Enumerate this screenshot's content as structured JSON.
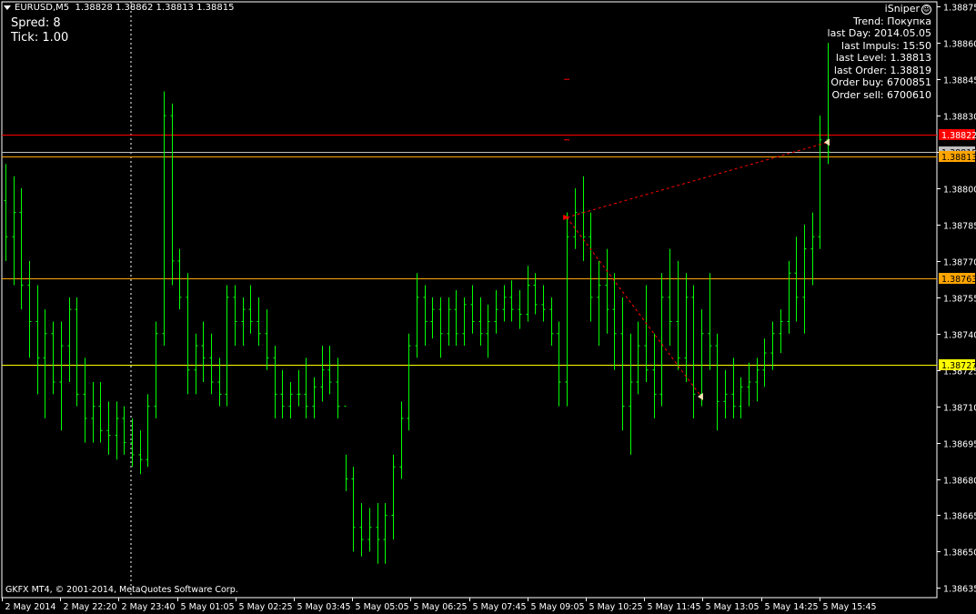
{
  "header": {
    "symbol": "EURUSD,M5",
    "ohlc": "1.38828 1.38862 1.38813 1.38815"
  },
  "info_left": {
    "spread": "Spred: 8",
    "tick": "Tick: 1.00"
  },
  "panel": {
    "title": "iSniper",
    "icon": "smiley-icon",
    "lines": [
      "Trend: Покупка",
      "last Day: 2014.05.05",
      "last Impuls: 15:50",
      "last Level: 1.38813",
      "last Order: 1.38819",
      "Order buy: 6700851",
      "Order sell: 6700610"
    ]
  },
  "copyright": "GKFX MT4, © 2001-2014, MetaQuotes Software Corp.",
  "colors": {
    "background": "#000000",
    "bars": "#00ff00",
    "axis": "#ffffff",
    "level_red": "#ff0000",
    "level_orange": "#ffa500",
    "level_yellow": "#ffff00",
    "level_grey": "#c0c0c0",
    "trade_line": "#ff0000"
  },
  "chart_data": {
    "type": "ohlc",
    "x_tick_labels": [
      "2 May 2014",
      "2 May 22:20",
      "2 May 23:40",
      "5 May 01:05",
      "5 May 02:25",
      "5 May 03:45",
      "5 May 05:05",
      "5 May 06:25",
      "5 May 07:45",
      "5 May 09:05",
      "5 May 10:25",
      "5 May 11:45",
      "5 May 13:05",
      "5 May 14:25",
      "5 May 15:45"
    ],
    "y_ticks": [
      1.38875,
      1.3886,
      1.38845,
      1.3883,
      1.38815,
      1.388,
      1.38785,
      1.3877,
      1.38755,
      1.3874,
      1.38725,
      1.3871,
      1.38695,
      1.3868,
      1.38665,
      1.3865,
      1.38635
    ],
    "y_tick_labels": [
      "1.38875",
      "1.38860",
      "1.38845",
      "1.38830",
      "1.38815",
      "1.38800",
      "1.38785",
      "1.38770",
      "1.38755",
      "1.38740",
      "1.38725",
      "1.38710",
      "1.38695",
      "1.38680",
      "1.38665",
      "1.38650",
      "1.38635"
    ],
    "ylim": [
      1.38631,
      1.38877
    ],
    "levels": [
      {
        "price": 1.38822,
        "label": "1.38822",
        "color": "#ff0000"
      },
      {
        "price": 1.38815,
        "label": "1.38815",
        "color": "#c0c0c0"
      },
      {
        "price": 1.38813,
        "label": "1.38813",
        "color": "#ffa500"
      },
      {
        "price": 1.38763,
        "label": "1.38763",
        "color": "#ffa500"
      },
      {
        "price": 1.38727,
        "label": "1.38727",
        "color": "#ffff00"
      }
    ],
    "bars": [
      [
        1.38795,
        1.3881,
        1.3877,
        1.3878
      ],
      [
        1.3878,
        1.38805,
        1.3876,
        1.3879
      ],
      [
        1.3879,
        1.388,
        1.3875,
        1.3876
      ],
      [
        1.3876,
        1.3877,
        1.3873,
        1.38745
      ],
      [
        1.38745,
        1.3876,
        1.38715,
        1.3873
      ],
      [
        1.3873,
        1.3875,
        1.38705,
        1.3874
      ],
      [
        1.3874,
        1.38745,
        1.38715,
        1.3872
      ],
      [
        1.3872,
        1.38745,
        1.387,
        1.38735
      ],
      [
        1.38735,
        1.38755,
        1.3872,
        1.3875
      ],
      [
        1.3875,
        1.38755,
        1.3871,
        1.38715
      ],
      [
        1.38715,
        1.3873,
        1.38695,
        1.38705
      ],
      [
        1.38705,
        1.3872,
        1.38695,
        1.3871
      ],
      [
        1.3871,
        1.3872,
        1.38695,
        1.387
      ],
      [
        1.387,
        1.38712,
        1.3869,
        1.38698
      ],
      [
        1.38698,
        1.38712,
        1.38688,
        1.38705
      ],
      [
        1.38705,
        1.3871,
        1.3869,
        1.38695
      ],
      [
        1.38695,
        1.38705,
        1.38685,
        1.3869
      ],
      [
        1.3869,
        1.387,
        1.38682,
        1.38688
      ],
      [
        1.38688,
        1.38715,
        1.38685,
        1.3871
      ],
      [
        1.3871,
        1.38745,
        1.38705,
        1.3874
      ],
      [
        1.3874,
        1.3884,
        1.38735,
        1.3883
      ],
      [
        1.3883,
        1.38835,
        1.3876,
        1.3877
      ],
      [
        1.3877,
        1.38775,
        1.3875,
        1.38755
      ],
      [
        1.38755,
        1.38765,
        1.38715,
        1.38725
      ],
      [
        1.38725,
        1.3874,
        1.38715,
        1.38735
      ],
      [
        1.38735,
        1.38745,
        1.3872,
        1.3873
      ],
      [
        1.3873,
        1.3874,
        1.38715,
        1.3872
      ],
      [
        1.3872,
        1.3873,
        1.3871,
        1.38715
      ],
      [
        1.38715,
        1.3876,
        1.3871,
        1.38755
      ],
      [
        1.38755,
        1.3876,
        1.38735,
        1.38745
      ],
      [
        1.38745,
        1.38755,
        1.38735,
        1.3875
      ],
      [
        1.3875,
        1.3876,
        1.3874,
        1.38745
      ],
      [
        1.38745,
        1.38755,
        1.38735,
        1.3874
      ],
      [
        1.3874,
        1.3875,
        1.38725,
        1.3873
      ],
      [
        1.3873,
        1.38735,
        1.38705,
        1.38715
      ],
      [
        1.38715,
        1.38725,
        1.38705,
        1.3871
      ],
      [
        1.3871,
        1.3872,
        1.38705,
        1.38715
      ],
      [
        1.38715,
        1.38725,
        1.3871,
        1.38715
      ],
      [
        1.38715,
        1.3873,
        1.38705,
        1.3871
      ],
      [
        1.3871,
        1.38722,
        1.38705,
        1.38718
      ],
      [
        1.38718,
        1.38735,
        1.38712,
        1.38725
      ],
      [
        1.38725,
        1.38735,
        1.38715,
        1.3872
      ],
      [
        1.3872,
        1.3873,
        1.38705,
        1.3871
      ],
      [
        1.3871,
        1.3869,
        1.38675,
        1.3868
      ],
      [
        1.3868,
        1.38685,
        1.3865,
        1.3866
      ],
      [
        1.3866,
        1.3867,
        1.38648,
        1.38655
      ],
      [
        1.38655,
        1.38668,
        1.3865,
        1.3866
      ],
      [
        1.3866,
        1.3867,
        1.38645,
        1.38655
      ],
      [
        1.38655,
        1.3867,
        1.38645,
        1.38665
      ],
      [
        1.38665,
        1.3869,
        1.38655,
        1.38685
      ],
      [
        1.38685,
        1.38712,
        1.3868,
        1.38705
      ],
      [
        1.38705,
        1.3874,
        1.387,
        1.38735
      ],
      [
        1.38735,
        1.38765,
        1.3873,
        1.38755
      ],
      [
        1.38755,
        1.3876,
        1.38735,
        1.38745
      ],
      [
        1.38745,
        1.38755,
        1.38738,
        1.3875
      ],
      [
        1.3875,
        1.38755,
        1.3873,
        1.3874
      ],
      [
        1.3874,
        1.38755,
        1.38735,
        1.3875
      ],
      [
        1.3875,
        1.38758,
        1.38735,
        1.3874
      ],
      [
        1.3874,
        1.38755,
        1.38735,
        1.38752
      ],
      [
        1.38752,
        1.3876,
        1.3874,
        1.38745
      ],
      [
        1.38745,
        1.38755,
        1.38735,
        1.3874
      ],
      [
        1.3874,
        1.38752,
        1.3873,
        1.38745
      ],
      [
        1.38745,
        1.38758,
        1.3874,
        1.3875
      ],
      [
        1.3875,
        1.3876,
        1.38745,
        1.38755
      ],
      [
        1.38755,
        1.38762,
        1.38745,
        1.3875
      ],
      [
        1.3875,
        1.38758,
        1.38742,
        1.38748
      ],
      [
        1.38748,
        1.38768,
        1.38745,
        1.3876
      ],
      [
        1.3876,
        1.38765,
        1.38748,
        1.38752
      ],
      [
        1.38752,
        1.3876,
        1.38745,
        1.3875
      ],
      [
        1.3875,
        1.38755,
        1.38735,
        1.3874
      ],
      [
        1.3874,
        1.38745,
        1.3871,
        1.3872
      ],
      [
        1.3872,
        1.3879,
        1.3871,
        1.3878
      ],
      [
        1.3878,
        1.388,
        1.38775,
        1.3879
      ],
      [
        1.3879,
        1.38805,
        1.3877,
        1.3878
      ],
      [
        1.3878,
        1.3879,
        1.38745,
        1.38755
      ],
      [
        1.38755,
        1.3877,
        1.38735,
        1.3876
      ],
      [
        1.3876,
        1.38775,
        1.3874,
        1.3875
      ],
      [
        1.3875,
        1.38765,
        1.38725,
        1.3874
      ],
      [
        1.3874,
        1.38755,
        1.387,
        1.3871
      ],
      [
        1.3871,
        1.3874,
        1.3869,
        1.3872
      ],
      [
        1.3872,
        1.38745,
        1.38715,
        1.38735
      ],
      [
        1.38735,
        1.3876,
        1.3872,
        1.38725
      ],
      [
        1.38725,
        1.3874,
        1.38705,
        1.38715
      ],
      [
        1.38715,
        1.38765,
        1.3871,
        1.38755
      ],
      [
        1.38755,
        1.38775,
        1.38735,
        1.38745
      ],
      [
        1.38745,
        1.3877,
        1.38725,
        1.3873
      ],
      [
        1.3873,
        1.38765,
        1.3872,
        1.38755
      ],
      [
        1.38755,
        1.3876,
        1.38705,
        1.38715
      ],
      [
        1.38715,
        1.3875,
        1.3871,
        1.3874
      ],
      [
        1.3874,
        1.38765,
        1.38725,
        1.38735
      ],
      [
        1.38735,
        1.3874,
        1.387,
        1.38712
      ],
      [
        1.38712,
        1.38725,
        1.38705,
        1.38715
      ],
      [
        1.38715,
        1.3873,
        1.38705,
        1.3871
      ],
      [
        1.3871,
        1.38722,
        1.38705,
        1.38718
      ],
      [
        1.38718,
        1.38728,
        1.3871,
        1.3872
      ],
      [
        1.3872,
        1.3873,
        1.38712,
        1.38725
      ],
      [
        1.38725,
        1.38738,
        1.38718,
        1.38732
      ],
      [
        1.38732,
        1.38745,
        1.38725,
        1.3874
      ],
      [
        1.3874,
        1.3875,
        1.38732,
        1.38745
      ],
      [
        1.38745,
        1.3877,
        1.3874,
        1.38765
      ],
      [
        1.38765,
        1.3878,
        1.38745,
        1.38755
      ],
      [
        1.38755,
        1.38785,
        1.3874,
        1.38775
      ],
      [
        1.38775,
        1.3879,
        1.3876,
        1.3878
      ],
      [
        1.3878,
        1.3883,
        1.38775,
        1.3882
      ],
      [
        1.3882,
        1.3886,
        1.3881,
        1.38815
      ]
    ],
    "trade_markers": [
      {
        "from": {
          "bar": 71,
          "price": 1.38788
        },
        "to": {
          "bar": 104,
          "price": 1.38819
        }
      },
      {
        "from": {
          "bar": 71,
          "price": 1.38788
        },
        "to": {
          "bar": 88,
          "price": 1.38714
        }
      }
    ]
  }
}
